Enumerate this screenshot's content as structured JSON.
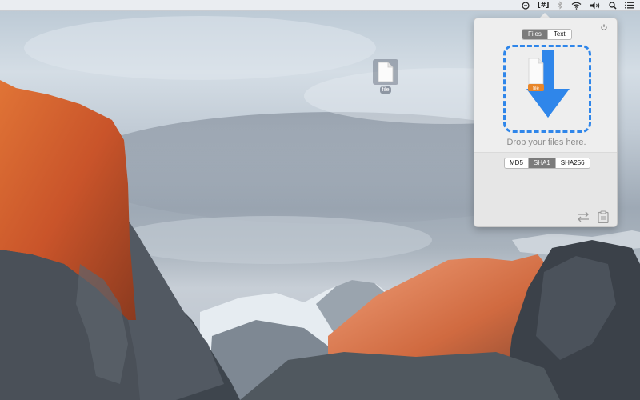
{
  "menubar": {
    "icons": [
      "sync-icon",
      "hash-app-icon",
      "bluetooth-icon",
      "wifi-icon",
      "volume-icon",
      "spotlight-search-icon",
      "notification-center-icon"
    ],
    "hash_label": "[#]"
  },
  "desktop": {
    "file_label": "file"
  },
  "popover": {
    "mode_tabs": [
      "Files",
      "Text"
    ],
    "mode_selected": "Files",
    "drop_badge": "file",
    "drop_text": "Drop your files here.",
    "hash_tabs": [
      "MD5",
      "SHA1",
      "SHA256"
    ],
    "hash_selected": "SHA1",
    "icons": {
      "power": "power-icon",
      "compare": "compare-arrows-icon",
      "clipboard": "clipboard-icon"
    },
    "accent_color": "#2f86ea"
  }
}
